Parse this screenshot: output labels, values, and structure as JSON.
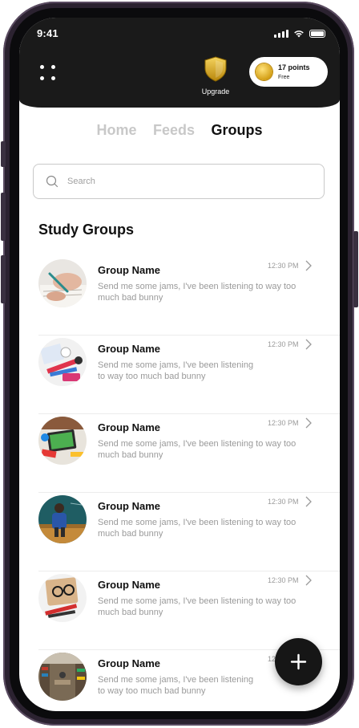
{
  "status_bar": {
    "time": "9:41"
  },
  "header": {
    "upgrade_label": "Upgrade",
    "points": {
      "title": "17 points",
      "subtitle": "Free"
    }
  },
  "tabs": [
    {
      "label": "Home",
      "active": false
    },
    {
      "label": "Feeds",
      "active": false
    },
    {
      "label": "Groups",
      "active": true
    }
  ],
  "search": {
    "placeholder": "Search"
  },
  "section_title": "Study Groups",
  "groups": [
    {
      "name": "Group Name",
      "message": "Send me some jams, I've been listening to way too much bad bunny",
      "time": "12:30 PM",
      "avatar": "writing-hand"
    },
    {
      "name": "Group Name",
      "message": "Send me some jams, I've been listening to way too much bad bunny",
      "time": "12:30 PM",
      "avatar": "art-supplies"
    },
    {
      "name": "Group Name",
      "message": "Send me some jams, I've been listening to way too much bad bunny",
      "time": "12:30 PM",
      "avatar": "tablet-desk"
    },
    {
      "name": "Group Name",
      "message": "Send me some jams, I've been listening to way too much bad bunny",
      "time": "12:30 PM",
      "avatar": "classroom"
    },
    {
      "name": "Group Name",
      "message": "Send me some jams, I've been listening to way too much bad bunny",
      "time": "12:30 PM",
      "avatar": "glasses-desk"
    },
    {
      "name": "Group Name",
      "message": "Send me some jams, I've been listening to way too much bad bunny",
      "time": "12:30 PM",
      "avatar": "library"
    }
  ],
  "colors": {
    "header_bg": "#1a1a1a",
    "tab_active": "#111111",
    "tab_inactive": "#c8c8c8",
    "fab_bg": "#161616"
  }
}
